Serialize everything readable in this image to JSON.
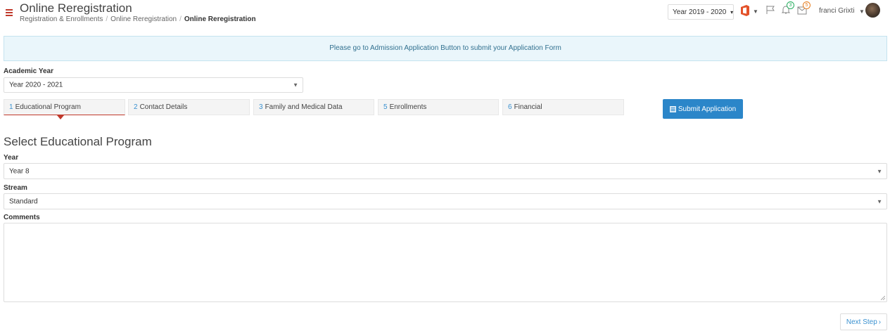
{
  "header": {
    "title": "Online Reregistration",
    "breadcrumb": [
      "Registration & Enrollments",
      "Online Reregistration",
      "Online Reregistration"
    ],
    "year_select": "Year 2019 - 2020",
    "notifications_count": "3",
    "messages_count": "5",
    "user_name": "franci Grixti"
  },
  "alert": {
    "message": "Please go to Admission Application Button to submit your Application Form"
  },
  "academic_year": {
    "label": "Academic Year",
    "value": "Year 2020 - 2021"
  },
  "steps": [
    {
      "num": "1",
      "label": "Educational Program"
    },
    {
      "num": "2",
      "label": "Contact Details"
    },
    {
      "num": "3",
      "label": "Family and Medical Data"
    },
    {
      "num": "5",
      "label": "Enrollments"
    },
    {
      "num": "6",
      "label": "Financial"
    }
  ],
  "submit_label": "Submit Application",
  "section_title": "Select Educational Program",
  "form": {
    "year_label": "Year",
    "year_value": "Year 8",
    "stream_label": "Stream",
    "stream_value": "Standard",
    "comments_label": "Comments",
    "comments_value": ""
  },
  "next_label": "Next Step",
  "colors": {
    "accent": "#c0392b",
    "primary": "#2b86c9",
    "alert_bg": "#eaf6fb"
  }
}
